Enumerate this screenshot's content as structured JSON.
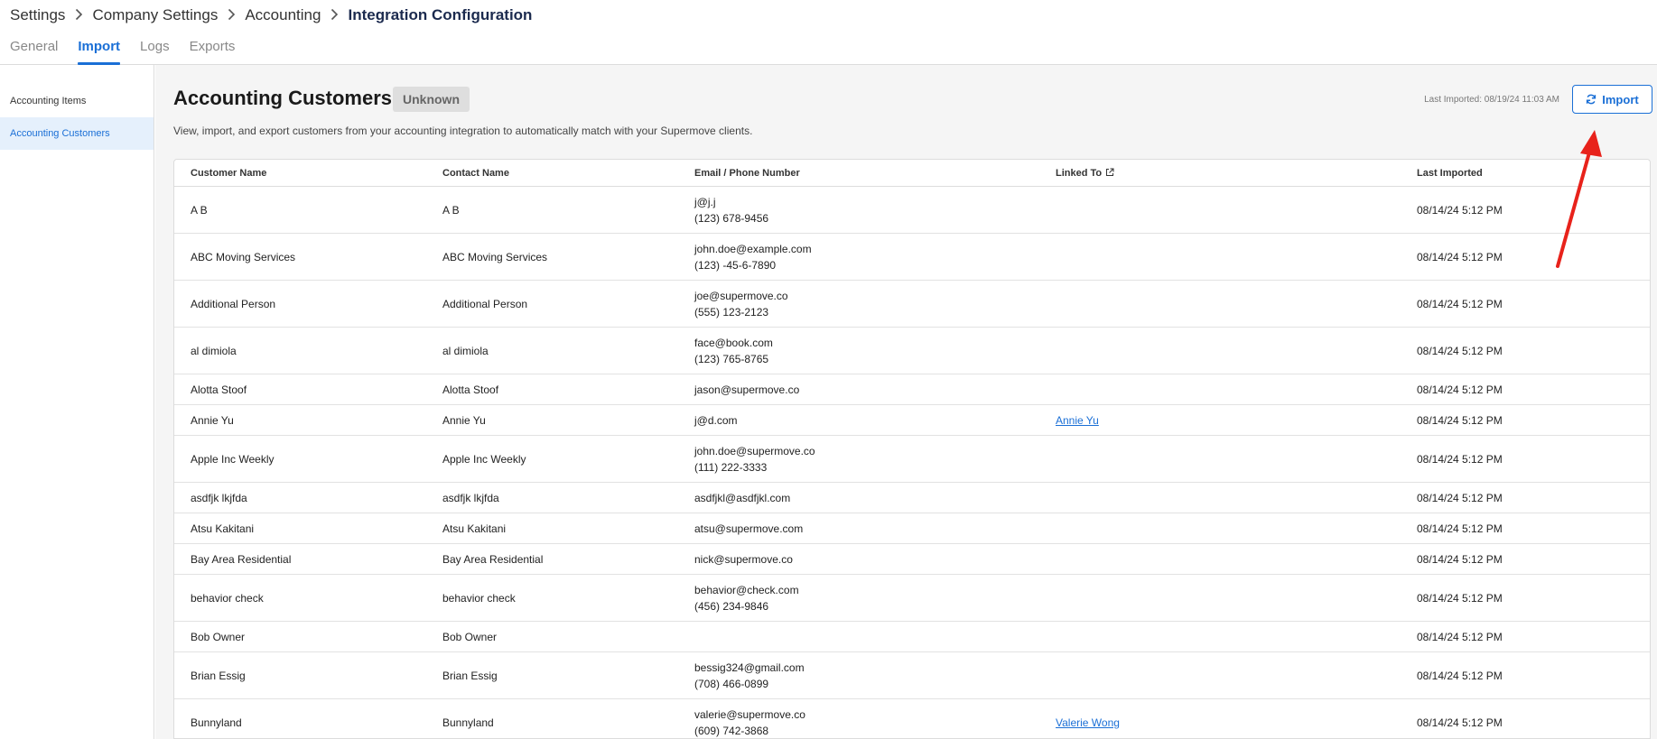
{
  "breadcrumb": {
    "items": [
      "Settings",
      "Company Settings",
      "Accounting"
    ],
    "current": "Integration Configuration"
  },
  "tabs": [
    "General",
    "Import",
    "Logs",
    "Exports"
  ],
  "active_tab": "Import",
  "sidebar": {
    "items": [
      "Accounting Items",
      "Accounting Customers"
    ],
    "active": "Accounting Customers"
  },
  "main": {
    "title": "Accounting Customers",
    "status_badge": "Unknown",
    "description": "View, import, and export customers from your accounting integration to automatically match with your Supermove clients.",
    "last_imported": "Last Imported: 08/19/24 11:03 AM",
    "import_label": "Import"
  },
  "table": {
    "headers": {
      "customer_name": "Customer Name",
      "contact_name": "Contact Name",
      "email_phone": "Email / Phone Number",
      "linked_to": "Linked To",
      "last_imported": "Last Imported"
    },
    "rows": [
      {
        "customer": "A B",
        "contact": "A B",
        "email": "j@j.j",
        "phone": "(123) 678-9456",
        "linked": "",
        "last": "08/14/24 5:12 PM"
      },
      {
        "customer": "ABC Moving Services",
        "contact": "ABC Moving Services",
        "email": "john.doe@example.com",
        "phone": "(123) -45-6-7890",
        "linked": "",
        "last": "08/14/24 5:12 PM"
      },
      {
        "customer": "Additional Person",
        "contact": "Additional Person",
        "email": "joe@supermove.co",
        "phone": "(555) 123-2123",
        "linked": "",
        "last": "08/14/24 5:12 PM"
      },
      {
        "customer": "al dimiola",
        "contact": "al dimiola",
        "email": "face@book.com",
        "phone": "(123) 765-8765",
        "linked": "",
        "last": "08/14/24 5:12 PM"
      },
      {
        "customer": "Alotta Stoof",
        "contact": "Alotta Stoof",
        "email": "jason@supermove.co",
        "phone": "",
        "linked": "",
        "last": "08/14/24 5:12 PM"
      },
      {
        "customer": "Annie Yu",
        "contact": "Annie Yu",
        "email": "j@d.com",
        "phone": "",
        "linked": "Annie Yu",
        "last": "08/14/24 5:12 PM"
      },
      {
        "customer": "Apple Inc Weekly",
        "contact": "Apple Inc Weekly",
        "email": "john.doe@supermove.co",
        "phone": "(111) 222-3333",
        "linked": "",
        "last": "08/14/24 5:12 PM"
      },
      {
        "customer": "asdfjk lkjfda",
        "contact": "asdfjk lkjfda",
        "email": "asdfjkl@asdfjkl.com",
        "phone": "",
        "linked": "",
        "last": "08/14/24 5:12 PM"
      },
      {
        "customer": "Atsu Kakitani",
        "contact": "Atsu Kakitani",
        "email": "atsu@supermove.com",
        "phone": "",
        "linked": "",
        "last": "08/14/24 5:12 PM"
      },
      {
        "customer": "Bay Area Residential",
        "contact": "Bay Area Residential",
        "email": "nick@supermove.co",
        "phone": "",
        "linked": "",
        "last": "08/14/24 5:12 PM"
      },
      {
        "customer": "behavior check",
        "contact": "behavior check",
        "email": "behavior@check.com",
        "phone": "(456) 234-9846",
        "linked": "",
        "last": "08/14/24 5:12 PM"
      },
      {
        "customer": "Bob Owner",
        "contact": "Bob Owner",
        "email": "",
        "phone": "",
        "linked": "",
        "last": "08/14/24 5:12 PM"
      },
      {
        "customer": "Brian Essig",
        "contact": "Brian Essig",
        "email": "bessig324@gmail.com",
        "phone": "(708) 466-0899",
        "linked": "",
        "last": "08/14/24 5:12 PM"
      },
      {
        "customer": "Bunnyland",
        "contact": "Bunnyland",
        "email": "valerie@supermove.co",
        "phone": "(609) 742-3868",
        "linked": "Valerie Wong",
        "last": "08/14/24 5:12 PM"
      }
    ]
  },
  "icons": {
    "breadcrumb_separator": "chevron-right-icon",
    "linked_to_header": "external-link-icon",
    "import_button": "refresh-icon"
  },
  "colors": {
    "accent": "#1a6fd6",
    "arrow": "#e8221b"
  }
}
